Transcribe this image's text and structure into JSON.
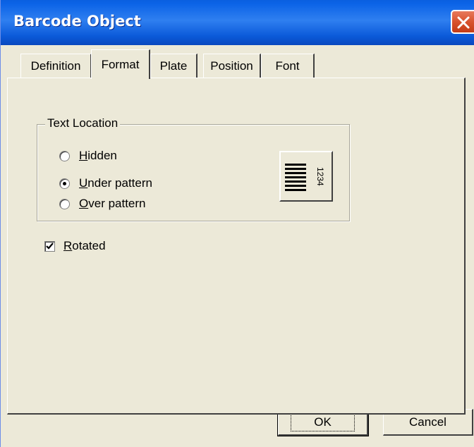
{
  "window": {
    "title": "Barcode Object"
  },
  "tabs": [
    {
      "label": "Definition",
      "active": false
    },
    {
      "label": "Format",
      "active": true
    },
    {
      "label": "Plate",
      "active": false
    },
    {
      "label": "Position",
      "active": false
    },
    {
      "label": "Font",
      "active": false
    }
  ],
  "text_location": {
    "group_label": "Text Location",
    "options": [
      {
        "mnemonic": "H",
        "rest": "idden",
        "checked": false
      },
      {
        "mnemonic": "U",
        "rest": "nder pattern",
        "checked": true
      },
      {
        "mnemonic": "O",
        "rest": "ver pattern",
        "checked": false
      }
    ],
    "preview_text": "1234"
  },
  "rotated": {
    "mnemonic": "R",
    "rest": "otated",
    "checked": true
  },
  "buttons": {
    "ok": "OK",
    "cancel": "Cancel"
  },
  "colors": {
    "titlebar": "#0b5fe0",
    "close": "#d8532e",
    "face": "#ece9d8"
  },
  "icons": {
    "close": "close-icon",
    "preview": "barcode-preview-icon",
    "check": "checkmark-icon"
  }
}
